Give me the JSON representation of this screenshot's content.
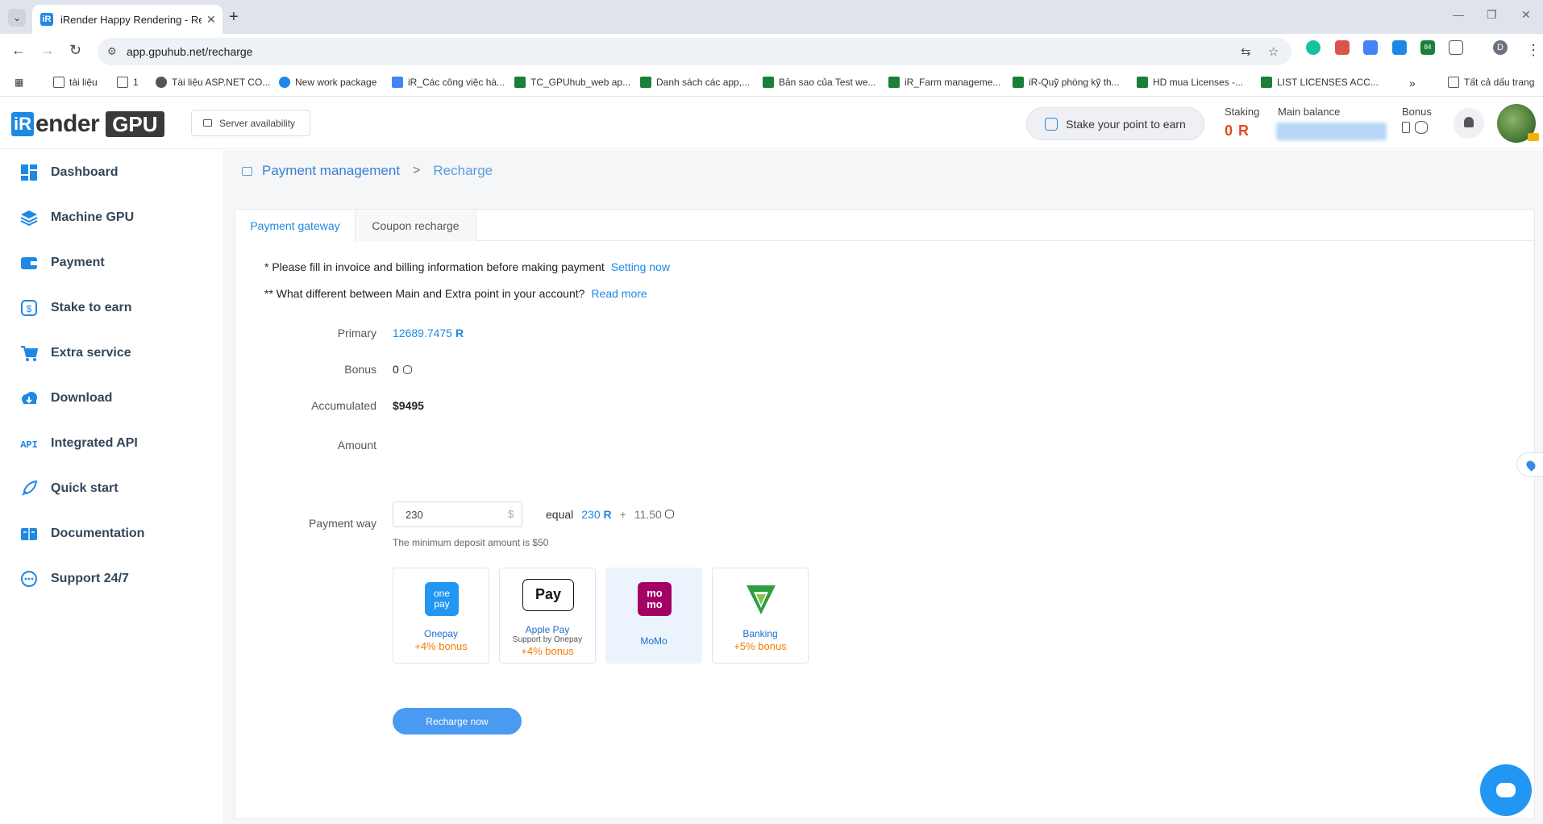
{
  "browser": {
    "tab_title": "iRender Happy Rendering - Ren",
    "tab_fav": "iR",
    "url": "app.gpuhub.net/recharge",
    "ext_badge": "84",
    "profile_initial": "D",
    "bookmarks": [
      "tài liệu",
      "1",
      "Tài liệu ASP.NET CO...",
      "New work package",
      "iR_Các công việc hà...",
      "TC_GPUhub_web ap...",
      "Danh sách các app,...",
      "Bản sao của Test we...",
      "iR_Farm manageme...",
      "iR-Quỹ phòng kỹ th...",
      "HD mua Licenses -...",
      "LIST LICENSES ACC..."
    ],
    "all_bookmarks": "Tất cả dấu trang"
  },
  "header": {
    "logo_i": "iR",
    "logo_render": "ender",
    "logo_gpu": "GPU",
    "server_availability": "Server availability",
    "stake_button": "Stake your point to earn",
    "staking_label": "Staking",
    "staking_value": "0 R",
    "main_balance_label": "Main balance",
    "bonus_label": "Bonus"
  },
  "sidebar": {
    "items": [
      {
        "label": "Dashboard",
        "icon": "dashboard-icon",
        "color": "#1e88e5"
      },
      {
        "label": "Machine GPU",
        "icon": "layers-icon",
        "color": "#1e88e5"
      },
      {
        "label": "Payment",
        "icon": "wallet-icon",
        "color": "#1e88e5"
      },
      {
        "label": "Stake to earn",
        "icon": "stake-icon",
        "color": "#1e88e5"
      },
      {
        "label": "Extra service",
        "icon": "cart-icon",
        "color": "#1e88e5"
      },
      {
        "label": "Download",
        "icon": "cloud-download-icon",
        "color": "#1e88e5"
      },
      {
        "label": "Integrated API",
        "icon": "api-icon",
        "color": "#1e88e5"
      },
      {
        "label": "Quick start",
        "icon": "rocket-icon",
        "color": "#1e88e5"
      },
      {
        "label": "Documentation",
        "icon": "book-icon",
        "color": "#1e88e5"
      },
      {
        "label": "Support 24/7",
        "icon": "chat-support-icon",
        "color": "#1e88e5"
      }
    ]
  },
  "breadcrumb": {
    "parent": "Payment management",
    "separator": ">",
    "current": "Recharge"
  },
  "tabs": {
    "gateway": "Payment gateway",
    "coupon": "Coupon recharge"
  },
  "notes": {
    "invoice_text": "* Please fill in invoice and billing information before making payment",
    "invoice_link": "Setting now",
    "difference_text": "** What different between Main and Extra point in your account?",
    "difference_link": "Read more"
  },
  "balances": {
    "primary_label": "Primary",
    "primary_value": "12689.7475",
    "bonus_label": "Bonus",
    "bonus_value": "0",
    "accumulated_label": "Accumulated",
    "accumulated_value": "$9495"
  },
  "amount": {
    "label": "Amount",
    "value": "230",
    "currency": "$",
    "equal_label": "equal",
    "points": "230",
    "plus": "+",
    "bonus_points": "11.50",
    "min_note": "The minimum deposit amount is $50"
  },
  "payment_way": {
    "label": "Payment way",
    "options": [
      {
        "name": "Onepay",
        "logo": "one\npay",
        "sub": "",
        "bonus": "+4% bonus",
        "selected": false
      },
      {
        "name": "Apple Pay",
        "logo": "Pay",
        "sub": "Support by Onepay",
        "bonus": "+4% bonus",
        "selected": false
      },
      {
        "name": "MoMo",
        "logo": "mo\nmo",
        "sub": "",
        "bonus": "",
        "selected": true
      },
      {
        "name": "Banking",
        "logo": "V",
        "sub": "",
        "bonus": "+5% bonus",
        "selected": false
      }
    ]
  },
  "recharge_button": "Recharge now",
  "colors": {
    "accent": "#1e88e5",
    "bonus_orange": "#f57c00",
    "staking_red": "#e64a19",
    "onepay_blue": "#2196f3",
    "momo_purple": "#a50064",
    "banking_green": "#2e9e3e"
  }
}
